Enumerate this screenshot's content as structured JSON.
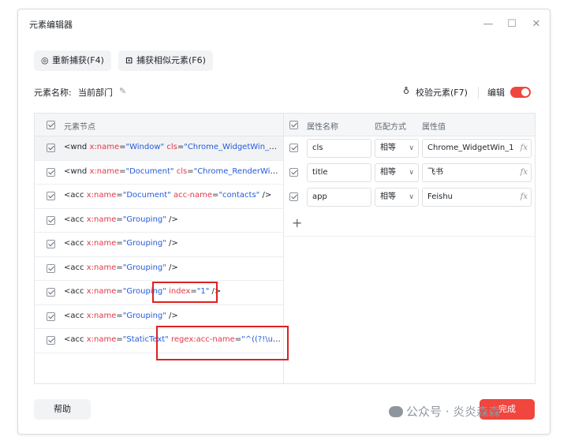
{
  "window": {
    "title": "元素编辑器"
  },
  "toolbar": {
    "recapture_label": "重新捕获(F4)",
    "capture_similar_label": "捕获相似元素(F6)"
  },
  "element": {
    "name_label": "元素名称:",
    "name_value": "当前部门",
    "verify_label": "校验元素(F7)",
    "edit_label": "编辑",
    "edit_enabled": true
  },
  "tree": {
    "header": "元素节点",
    "nodes": [
      {
        "tag": "wnd",
        "attrs": [
          {
            "k": "x:name",
            "v": "\"Window\""
          },
          {
            "k": "cls",
            "v": "\"Chrome_WidgetWin_1\""
          }
        ],
        "tail": " t...",
        "selected": true
      },
      {
        "tag": "wnd",
        "attrs": [
          {
            "k": "x:name",
            "v": "\"Document\""
          },
          {
            "k": "cls",
            "v": "\"Chrome_RenderWidg..."
          }
        ],
        "tail": "",
        "selected": false
      },
      {
        "tag": "acc",
        "attrs": [
          {
            "k": "x:name",
            "v": "\"Document\""
          },
          {
            "k": "acc-name",
            "v": "\"contacts\""
          }
        ],
        "tail": " />",
        "selected": false
      },
      {
        "tag": "acc",
        "attrs": [
          {
            "k": "x:name",
            "v": "\"Grouping\""
          }
        ],
        "tail": " />",
        "selected": false
      },
      {
        "tag": "acc",
        "attrs": [
          {
            "k": "x:name",
            "v": "\"Grouping\""
          }
        ],
        "tail": " />",
        "selected": false
      },
      {
        "tag": "acc",
        "attrs": [
          {
            "k": "x:name",
            "v": "\"Grouping\""
          }
        ],
        "tail": " />",
        "selected": false
      },
      {
        "tag": "acc",
        "attrs": [
          {
            "k": "x:name",
            "v": "\"Grouping\""
          },
          {
            "k": "index",
            "v": "\"1\""
          }
        ],
        "tail": " />",
        "selected": false
      },
      {
        "tag": "acc",
        "attrs": [
          {
            "k": "x:name",
            "v": "\"Grouping\""
          }
        ],
        "tail": " />",
        "selected": false
      },
      {
        "tag": "acc",
        "attrs": [
          {
            "k": "x:name",
            "v": "\"StaticText\""
          },
          {
            "k": "regex:acc-name",
            "v": "\"^((?!\\ue60..."
          }
        ],
        "tail": "",
        "selected": false
      }
    ]
  },
  "attributes": {
    "headers": {
      "name": "属性名称",
      "match": "匹配方式",
      "value": "属性值"
    },
    "rows": [
      {
        "name": "cls",
        "match": "相等",
        "value": "Chrome_WidgetWin_1"
      },
      {
        "name": "title",
        "match": "相等",
        "value": "飞书"
      },
      {
        "name": "app",
        "match": "相等",
        "value": "Feishu"
      }
    ],
    "add_symbol": "+"
  },
  "footer": {
    "help_label": "帮助",
    "done_label": "完成"
  },
  "watermark": {
    "text": "公众号 · 炎炎森森"
  }
}
